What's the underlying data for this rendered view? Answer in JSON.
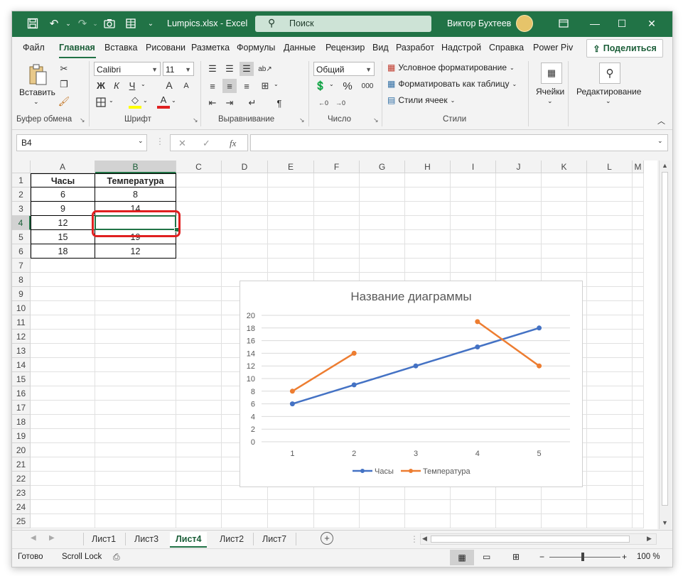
{
  "title_bar": {
    "file_name": "Lumpics.xlsx  -  Excel",
    "search_placeholder": "Поиск",
    "user_name": "Виктор Бухтеев"
  },
  "ribbon_tabs": [
    "Файл",
    "Главная",
    "Вставка",
    "Рисовани",
    "Разметка",
    "Формулы",
    "Данные",
    "Рецензир",
    "Вид",
    "Разработ",
    "Надстрой",
    "Справка",
    "Power Piv"
  ],
  "share_label": "Поделиться",
  "ribbon": {
    "clipboard": {
      "paste_label": "Вставить",
      "group_label": "Буфер обмена"
    },
    "font": {
      "font_name": "Calibri",
      "font_size": "11",
      "bold": "Ж",
      "italic": "К",
      "underline": "Ч",
      "grow": "A",
      "shrink": "A",
      "group_label": "Шрифт",
      "fill_color": "#ffff00",
      "font_color": "#e02020"
    },
    "alignment": {
      "group_label": "Выравнивание"
    },
    "number": {
      "format": "Общий",
      "group_label": "Число",
      "percent": "%",
      "thousands": "000"
    },
    "styles": {
      "conditional_formatting": "Условное форматирование",
      "format_as_table": "Форматировать как таблицу",
      "cell_styles": "Стили ячеек",
      "group_label": "Стили"
    },
    "cells": {
      "label": "Ячейки"
    },
    "editing": {
      "label": "Редактирование"
    }
  },
  "formula_bar": {
    "name_box": "B4",
    "fx": "fx",
    "formula": ""
  },
  "columns": [
    "A",
    "B",
    "C",
    "D",
    "E",
    "F",
    "G",
    "H",
    "I",
    "J",
    "K",
    "L",
    "M"
  ],
  "rows": [
    "1",
    "2",
    "3",
    "4",
    "5",
    "6",
    "7",
    "8",
    "9",
    "10",
    "11",
    "12",
    "13",
    "14",
    "15",
    "16",
    "17",
    "18",
    "19",
    "20",
    "21",
    "22",
    "23",
    "24",
    "25"
  ],
  "table": {
    "headers": [
      "Часы",
      "Температура"
    ],
    "data": [
      [
        "6",
        "8"
      ],
      [
        "9",
        "14"
      ],
      [
        "12",
        ""
      ],
      [
        "15",
        "19"
      ],
      [
        "18",
        "12"
      ]
    ]
  },
  "selected_cell": "B4",
  "sheets": [
    "Лист1",
    "Лист3",
    "Лист4",
    "Лист2",
    "Лист7"
  ],
  "active_sheet": "Лист4",
  "status": {
    "ready": "Готово",
    "scroll_lock": "Scroll Lock",
    "zoom": "100 %"
  },
  "chart_data": {
    "type": "line",
    "title": "Название диаграммы",
    "categories": [
      "1",
      "2",
      "3",
      "4",
      "5"
    ],
    "ylim": [
      0,
      20
    ],
    "yticks": [
      "0",
      "2",
      "4",
      "6",
      "8",
      "10",
      "12",
      "14",
      "16",
      "18",
      "20"
    ],
    "grid": true,
    "legend_position": "bottom",
    "series": [
      {
        "name": "Часы",
        "values": [
          6,
          9,
          12,
          15,
          18
        ],
        "color": "#4472c4"
      },
      {
        "name": "Температура",
        "values": [
          8,
          14,
          null,
          19,
          12
        ],
        "color": "#ed7d31"
      }
    ]
  }
}
